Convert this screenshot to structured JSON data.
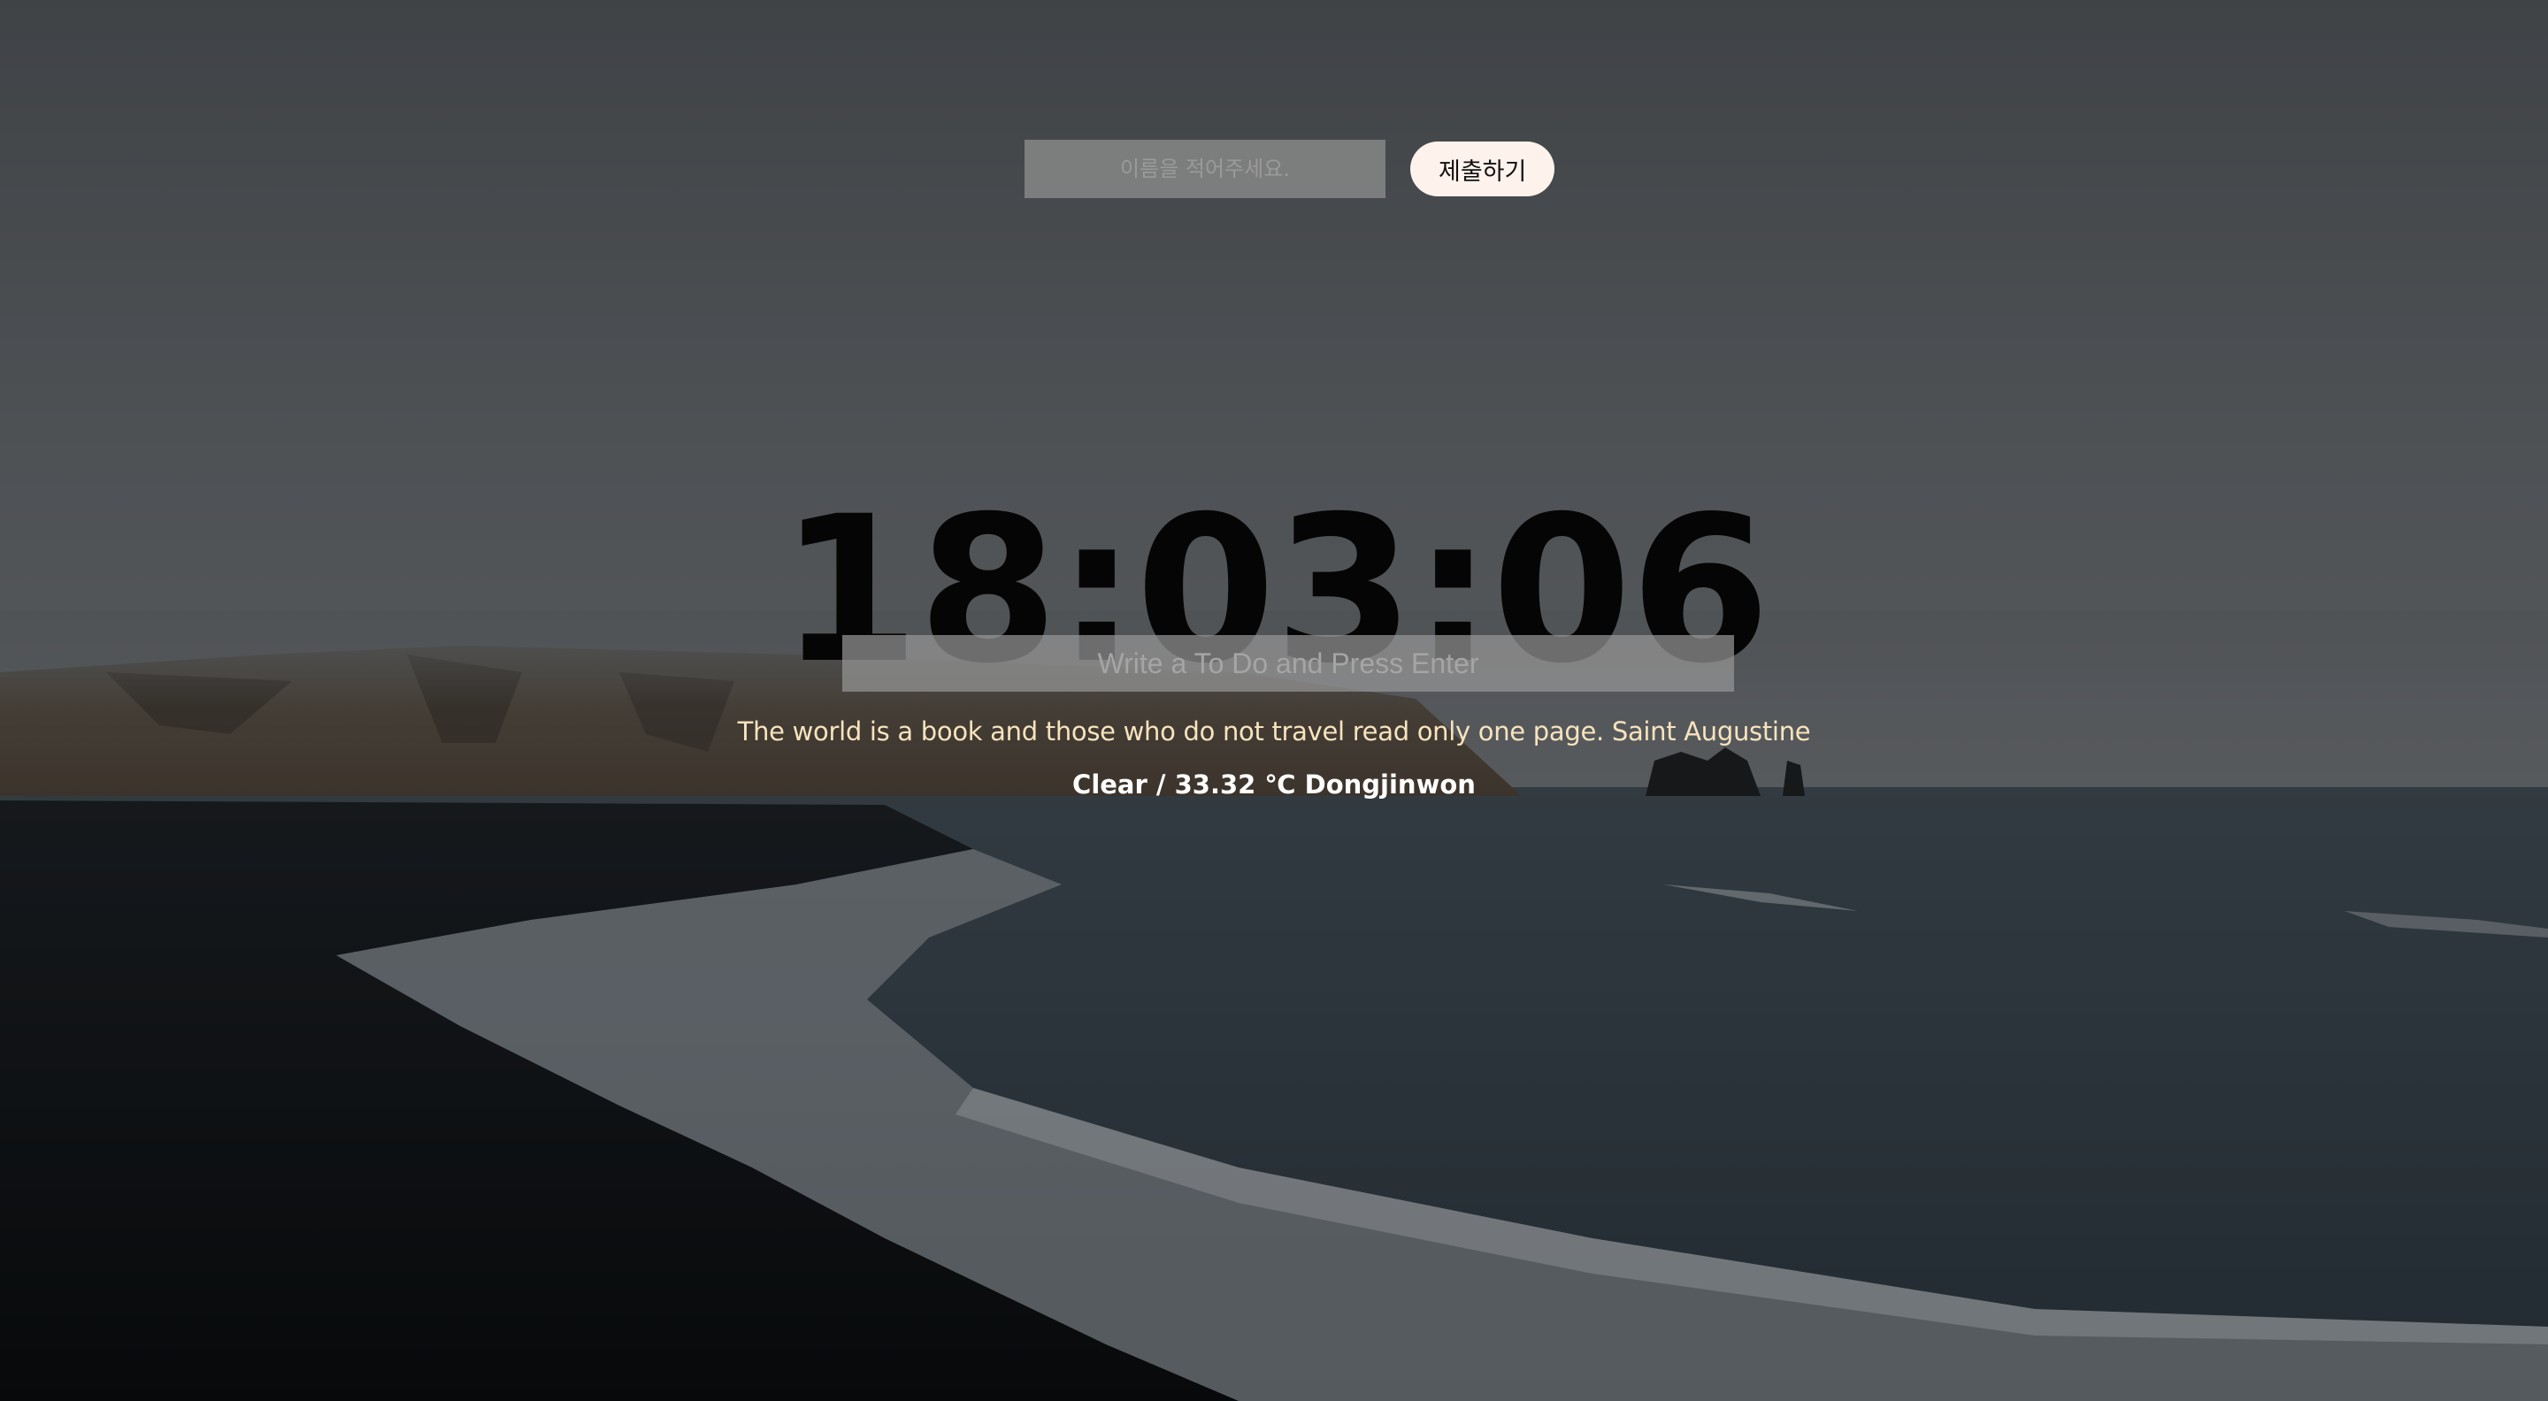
{
  "login": {
    "name_placeholder": "이름을 적어주세요.",
    "submit_label": "제출하기"
  },
  "clock": {
    "time": "18:03:06"
  },
  "todo": {
    "placeholder": "Write a To Do and Press Enter"
  },
  "quote": {
    "text": "The world is a book and those who do not travel read only one page.",
    "author": "Saint Augustine"
  },
  "weather": {
    "condition": "Clear",
    "separator": " / ",
    "temperature": "33.32 ℃",
    "location": "Dongjinwon"
  },
  "colors": {
    "clock": "#050505",
    "quote": "#f7e3bd",
    "button_bg": "#fdf2ec",
    "input_bg": "#8c8c8c"
  }
}
